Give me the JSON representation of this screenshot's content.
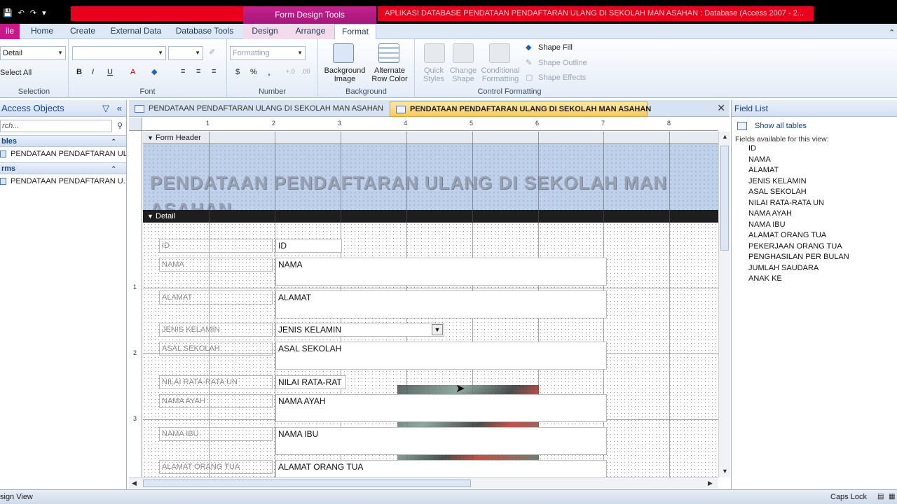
{
  "title_bar": {
    "tool_context": "Form Design Tools",
    "app_title": "APLIKASI DATABASE PENDATAAN PENDAFTARAN ULANG DI SEKOLAH MAN ASAHAN : Database (Access 2007 - 2..."
  },
  "ribbon_tabs": [
    "ile",
    "Home",
    "Create",
    "External Data",
    "Database Tools",
    "Design",
    "Arrange",
    "Format"
  ],
  "ribbon": {
    "selection": {
      "object_combo": "Detail",
      "select_all": "Select All",
      "label": "Selection"
    },
    "font": {
      "font_combo": "",
      "size_combo": "",
      "label": "Font",
      "bold": "B",
      "italic": "I",
      "underline": "U",
      "font_color": "A"
    },
    "number": {
      "format_combo": "Formatting",
      "currency": "$",
      "percent": "%",
      "comma": ",",
      "label": "Number"
    },
    "background": {
      "background_image": "Background Image",
      "alternate_row_color": "Alternate Row Color",
      "label": "Background"
    },
    "control_formatting": {
      "quick_styles": "Quick Styles",
      "change_shape": "Change Shape",
      "conditional_formatting": "Conditional Formatting",
      "shape_fill": "Shape Fill",
      "shape_outline": "Shape Outline",
      "shape_effects": "Shape Effects",
      "label": "Control Formatting"
    }
  },
  "nav_pane": {
    "title": "Access Objects",
    "search_placeholder": "rch...",
    "sections": [
      {
        "label": "bles",
        "items": [
          "PENDATAAN PENDAFTARAN ULANG DI SEKOLAH MAN ASAHAN"
        ]
      },
      {
        "label": "rms",
        "items": [
          "PENDATAAN PENDAFTARAN U..."
        ]
      }
    ]
  },
  "doc_tabs": [
    {
      "label": "PENDATAAN PENDAFTARAN ULANG DI SEKOLAH MAN ASAHAN",
      "active": false
    },
    {
      "label": "PENDATAAN PENDAFTARAN ULANG DI SEKOLAH MAN ASAHAN",
      "active": true
    }
  ],
  "ruler_numbers": [
    "1",
    "2",
    "3",
    "4",
    "5",
    "6",
    "7",
    "8"
  ],
  "ruler_left_numbers": [
    "1",
    "2",
    "3"
  ],
  "form": {
    "header_section": "Form Header",
    "detail_section": "Detail",
    "title": "PENDATAAN PENDAFTARAN ULANG DI SEKOLAH MAN ASAHAN",
    "fields": [
      {
        "label": "ID",
        "control": "ID"
      },
      {
        "label": "NAMA",
        "control": "NAMA"
      },
      {
        "label": "ALAMAT",
        "control": "ALAMAT"
      },
      {
        "label": "JENIS KELAMIN",
        "control": "JENIS KELAMIN"
      },
      {
        "label": "ASAL SEKOLAH",
        "control": "ASAL SEKOLAH"
      },
      {
        "label": "NILAI RATA-RATA UN",
        "control": "NILAI RATA-RAT"
      },
      {
        "label": "NAMA AYAH",
        "control": "NAMA AYAH"
      },
      {
        "label": "NAMA IBU",
        "control": "NAMA IBU"
      },
      {
        "label": "ALAMAT ORANG TUA",
        "control": "ALAMAT ORANG TUA"
      }
    ]
  },
  "field_list": {
    "title": "Field List",
    "show_all": "Show all tables",
    "available_label": "Fields available for this view:",
    "fields": [
      "ID",
      "NAMA",
      "ALAMAT",
      "JENIS KELAMIN",
      "ASAL SEKOLAH",
      "NILAI RATA-RATA UN",
      "NAMA AYAH",
      "NAMA IBU",
      "ALAMAT ORANG TUA",
      "PEKERJAAN ORANG TUA",
      "PENGHASILAN PER BULAN",
      "JUMLAH SAUDARA",
      "ANAK KE"
    ]
  },
  "status_bar": {
    "view": "sign View",
    "caps_lock": "Caps Lock"
  },
  "colors": {
    "title_red": "#e8001c",
    "context_tab": "#c9208c",
    "accent_blue": "#15428b"
  }
}
